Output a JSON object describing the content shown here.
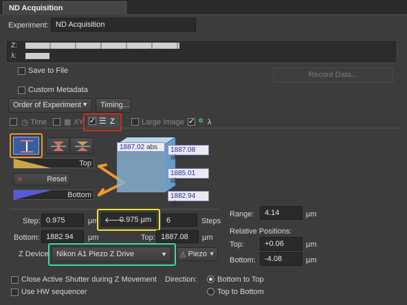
{
  "window": {
    "tab_title": "ND Acquisition"
  },
  "experiment": {
    "label": "Experiment:",
    "value": "ND Acquisition"
  },
  "loops": {
    "z_label": "Z:",
    "lambda_label": "λ:"
  },
  "save": {
    "label": "Save to File",
    "record": "Record Data..."
  },
  "metadata": {
    "label": "Custom Metadata"
  },
  "order": {
    "select": "Order of Experiment",
    "timing": "Timing..."
  },
  "tabs": {
    "time": "Time",
    "xy": "XY",
    "z": "Z",
    "large": "Large Image",
    "lambda": "λ"
  },
  "zpanel": {
    "top_btn": "Top",
    "reset_btn": "Reset",
    "bottom_btn": "Bottom",
    "cube": {
      "top_abs_left": "1887.02",
      "top_abs_right": "1887.08",
      "mid_abs": "1885.01",
      "bottom_abs": "1882.94",
      "unit": "abs"
    },
    "step_label": "Step:",
    "step_value": "0.975",
    "step_unit": "µm",
    "step_calc": "0.975 µm",
    "steps_value": "6",
    "steps_label": "Steps",
    "bottom_label": "Bottom:",
    "bottom_value": "1882.94",
    "top_label": "Top:",
    "top_value": "1887.08",
    "range_label": "Range:",
    "range_value": "4.14",
    "range_unit": "µm",
    "rel_label": "Relative Positions:",
    "rel_top_label": "Top:",
    "rel_top_value": "+0.06",
    "rel_top_unit": "µm",
    "rel_bottom_label": "Bottom:",
    "rel_bottom_value": "-4.08",
    "rel_bottom_unit": "µm",
    "device_label": "Z Device:",
    "device_value": "Nikon A1 Piezo Z Drive",
    "piezo": "Piezo",
    "close_shutter": "Close Active Shutter during Z Movement",
    "hw_seq": "Use HW sequencer",
    "direction_label": "Direction:",
    "dir_bt": "Bottom to Top",
    "dir_tb": "Top to Bottom"
  },
  "colors": {
    "orange": "#f0962a",
    "red": "#c8321e",
    "yellow": "#f2e43a",
    "green": "#43d9a0"
  }
}
